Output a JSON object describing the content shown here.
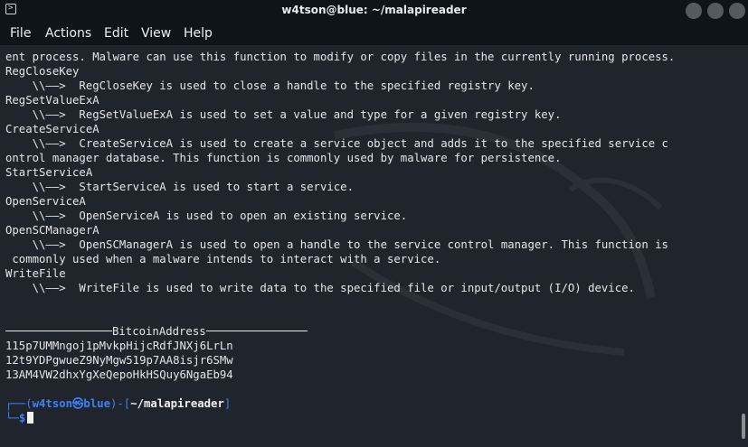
{
  "window": {
    "title": "w4tson@blue: ~/malapireader",
    "terminal_icon": "terminal-icon"
  },
  "menu": [
    "File",
    "Actions",
    "Edit",
    "View",
    "Help"
  ],
  "terminal": {
    "lines": [
      "ent process. Malware can use this function to modify or copy files in the currently running process.",
      "RegCloseKey",
      "    \\\\——>  RegCloseKey is used to close a handle to the specified registry key.",
      "RegSetValueExA",
      "    \\\\——>  RegSetValueExA is used to set a value and type for a given registry key.",
      "CreateServiceA",
      "    \\\\——>  CreateServiceA is used to create a service object and adds it to the specified service c",
      "ontrol manager database. This function is commonly used by malware for persistence.",
      "StartServiceA",
      "    \\\\——>  StartServiceA is used to start a service.",
      "OpenServiceA",
      "    \\\\——>  OpenServiceA is used to open an existing service.",
      "OpenSCManagerA",
      "    \\\\——>  OpenSCManagerA is used to open a handle to the service control manager. This function is",
      " commonly used when a malware intends to interact with a service.",
      "WriteFile",
      "    \\\\——>  WriteFile is used to write data to the specified file or input/output (I/O) device."
    ],
    "bitcoin_header": "BitcoinAddress",
    "bitcoin_addresses": [
      "115p7UMMngoj1pMvkpHijcRdfJNXj6LrLn",
      "12t9YDPgwueZ9NyMgw519p7AA8isjr6SMw",
      "13AM4VW2dhxYgXeQepoHkHSQuy6NgaEb94"
    ],
    "prompt": {
      "user": "w4tson",
      "at_symbol": "㉿",
      "host": "blue",
      "path": "~/malapireader",
      "dollar": "$"
    }
  }
}
